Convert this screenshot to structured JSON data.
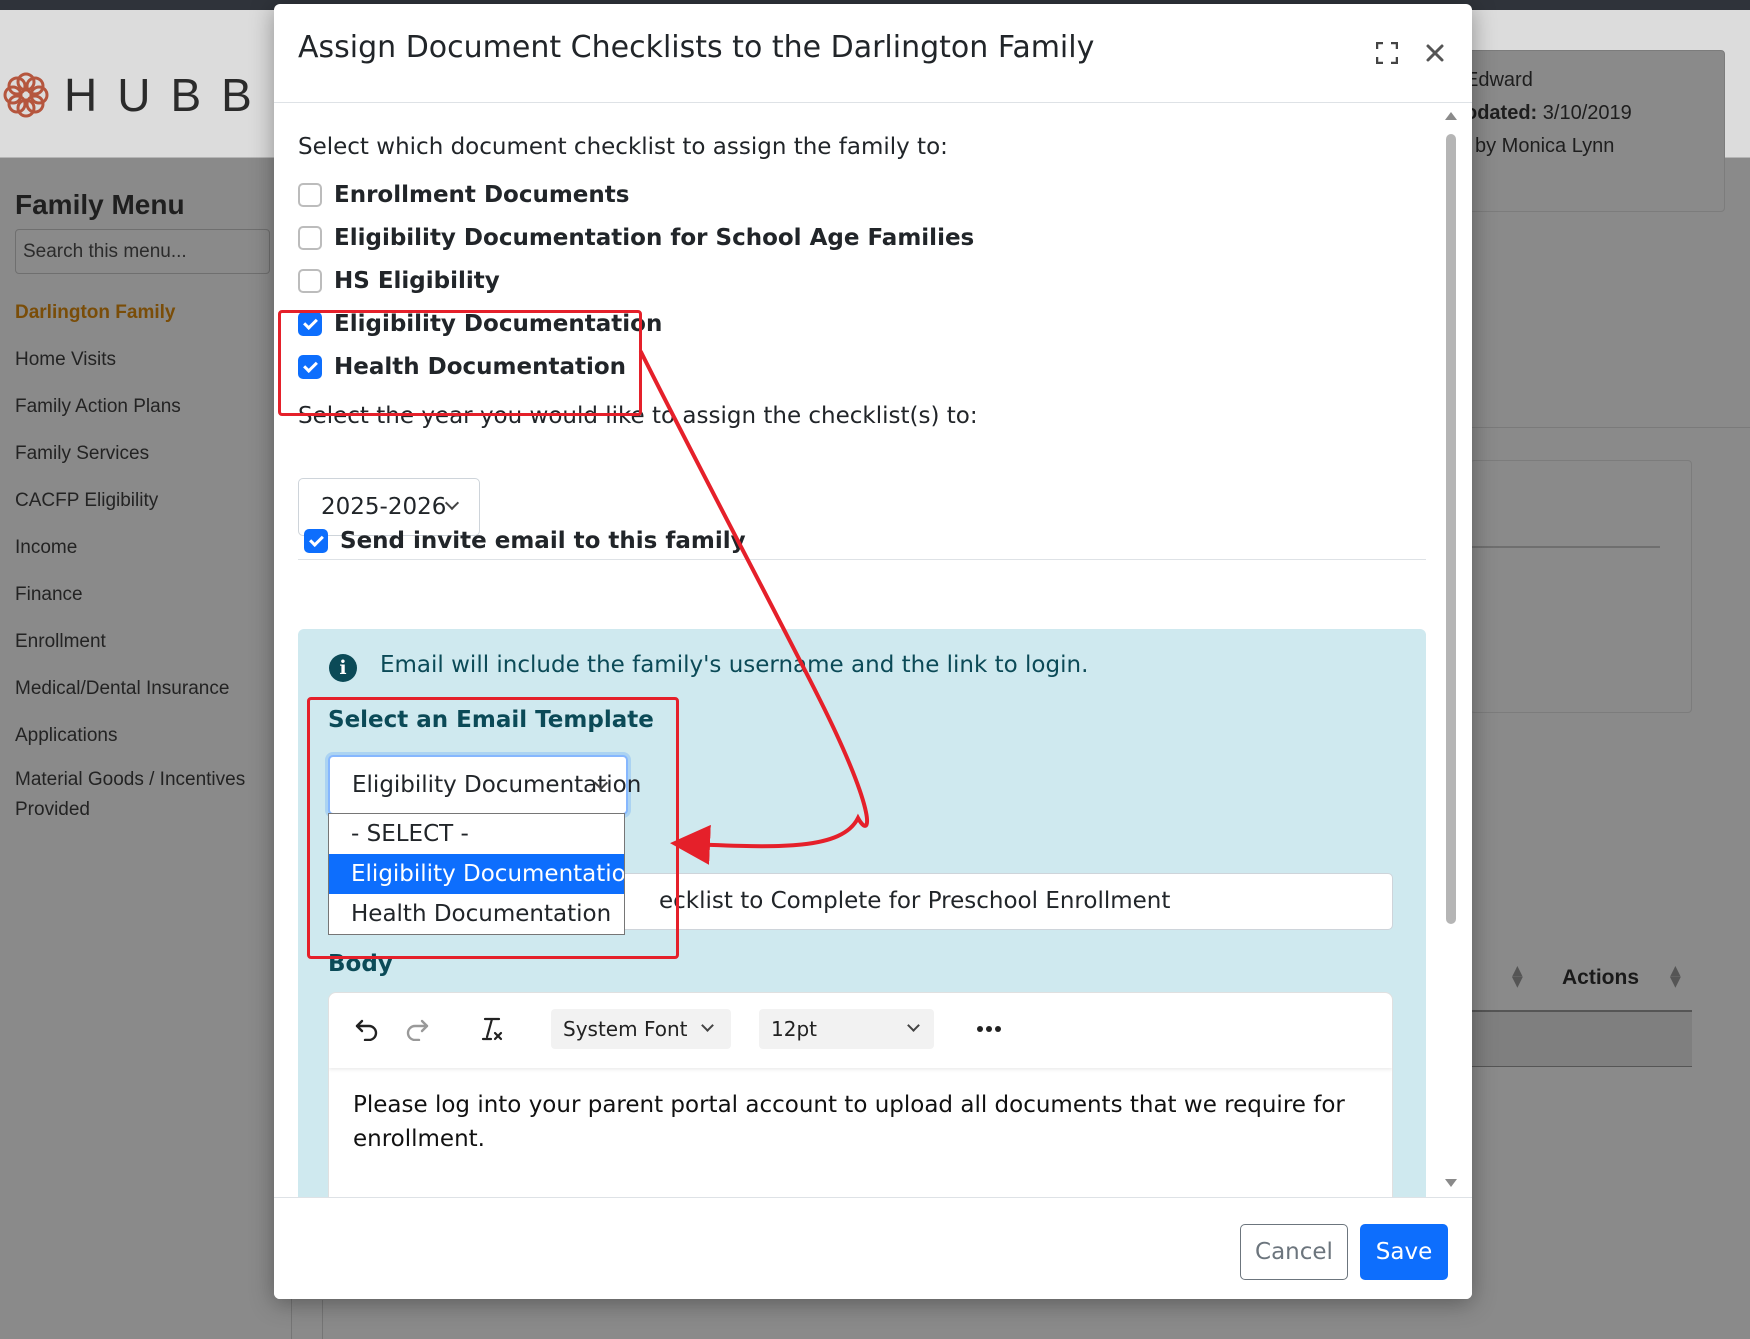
{
  "background": {
    "brand_text": "HUBBE",
    "sidebar": {
      "title": "Family Menu",
      "search_placeholder": "Search this menu...",
      "items": [
        {
          "label": "Darlington Family"
        },
        {
          "label": "Home Visits"
        },
        {
          "label": "Family Action Plans"
        },
        {
          "label": "Family Services"
        },
        {
          "label": "CACFP Eligibility"
        },
        {
          "label": "Income"
        },
        {
          "label": "Finance"
        },
        {
          "label": "Enrollment"
        },
        {
          "label": "Medical/Dental Insurance"
        },
        {
          "label": "Applications"
        },
        {
          "label": "Material Goods / Incentives Provided"
        }
      ]
    },
    "info": {
      "line1": "Edward",
      "updated_label": "odated:",
      "updated_value": "3/10/2019",
      "line3": "l by Monica Lynn"
    },
    "table": {
      "actions_header": "Actions"
    }
  },
  "modal": {
    "title": "Assign Document Checklists to the Darlington Family",
    "checklist_prompt": "Select which document checklist to assign the family to:",
    "checklists": [
      {
        "label": "Enrollment Documents",
        "checked": false
      },
      {
        "label": "Eligibility Documentation for School Age Families",
        "checked": false
      },
      {
        "label": "HS Eligibility",
        "checked": false
      },
      {
        "label": "Eligibility Documentation",
        "checked": true
      },
      {
        "label": "Health Documentation",
        "checked": true
      }
    ],
    "year_prompt": "Select the year you would like to assign the checklist(s) to:",
    "year_value": "2025-2026",
    "send_invite": {
      "label": "Send invite email to this family",
      "checked": true
    },
    "info_text": "Email will include the family's username and the link to login.",
    "template_label": "Select an Email Template",
    "template_value": "Eligibility Documentation",
    "template_options": [
      {
        "label": "- SELECT -",
        "selected": false
      },
      {
        "label": "Eligibility Documentation",
        "selected": true
      },
      {
        "label": "Health Documentation",
        "selected": false
      }
    ],
    "subject_visible": "ecklist to Complete for Preschool Enrollment",
    "body_label": "Body",
    "editor": {
      "font_family": "System Font",
      "font_size": "12pt",
      "content": "Please log into your parent portal account to upload all documents that we require for enrollment."
    },
    "buttons": {
      "cancel": "Cancel",
      "save": "Save"
    }
  },
  "colors": {
    "primary": "#0d6efd",
    "info_bg": "#cfe9ef",
    "info_text": "#0b4a57",
    "annotation": "#e5202a",
    "active_menu": "#7a4d08"
  }
}
